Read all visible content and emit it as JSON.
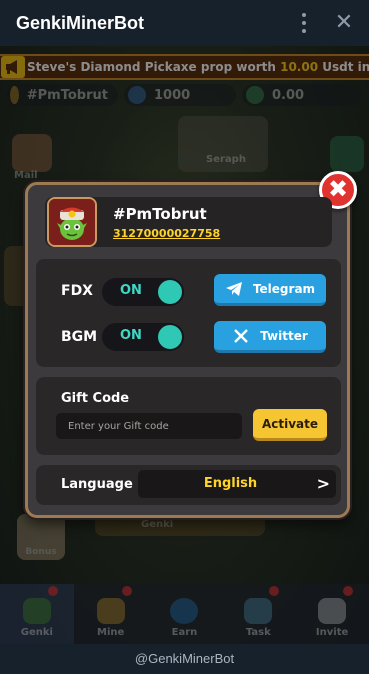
{
  "window": {
    "title": "GenkiMinerBot",
    "footer": "@GenkiMinerBot"
  },
  "ticker": {
    "part1": "Steve's Diamond Pickaxe",
    "part2": " prop worth ",
    "part3": "10.00",
    "part4": " Usdt in Artifacts"
  },
  "background": {
    "stats": [
      "#PmTobrut",
      "1000",
      "0.00"
    ],
    "labels": [
      "Mail",
      "Seraph",
      "Genki"
    ],
    "bonus_label": "Bonus"
  },
  "bottom_nav": [
    {
      "label": "Genki",
      "color": "#4fa03a"
    },
    {
      "label": "Mine",
      "color": "#d8a838"
    },
    {
      "label": "Earn",
      "color": "#2b86d4"
    },
    {
      "label": "Task",
      "color": "#5ba6c8"
    },
    {
      "label": "Invite",
      "color": "#d6dde3"
    }
  ],
  "settings": {
    "username": "#PmTobrut",
    "user_id": "31270000027758",
    "fdx_label": "FDX",
    "fdx_state": "ON",
    "bgm_label": "BGM",
    "bgm_state": "ON",
    "telegram_label": "Telegram",
    "twitter_label": "Twitter",
    "gift_code_title": "Gift Code",
    "gift_code_placeholder": "Enter your Gift code",
    "gift_code_value": "",
    "activate_label": "Activate",
    "language_label": "Language",
    "language_value": "English"
  },
  "colors": {
    "accent_yellow": "#ffd42a",
    "toggle_teal": "#2fc8b4",
    "social_blue": "#29a1e0",
    "close_red": "#e0322f"
  }
}
